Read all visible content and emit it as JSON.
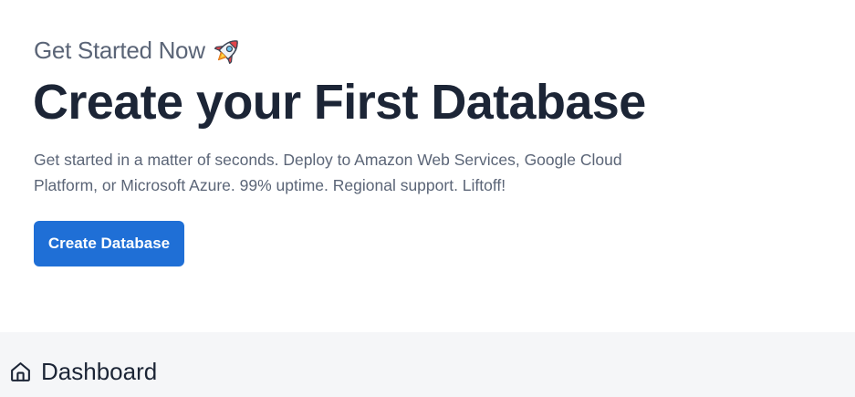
{
  "hero": {
    "eyebrow": "Get Started Now",
    "eyebrow_icon": "rocket-icon",
    "title": "Create your First Database",
    "description": "Get started in a matter of seconds. Deploy to Amazon Web Services, Google Cloud Platform, or Microsoft Azure. 99% uptime. Regional support. Liftoff!",
    "cta_label": "Create Database"
  },
  "dashboard": {
    "icon": "home-icon",
    "title": "Dashboard"
  },
  "colors": {
    "primary_button": "#1f6fd6",
    "heading": "#1c2536",
    "muted_text": "#5b6577",
    "band_background": "#f5f6f8"
  }
}
